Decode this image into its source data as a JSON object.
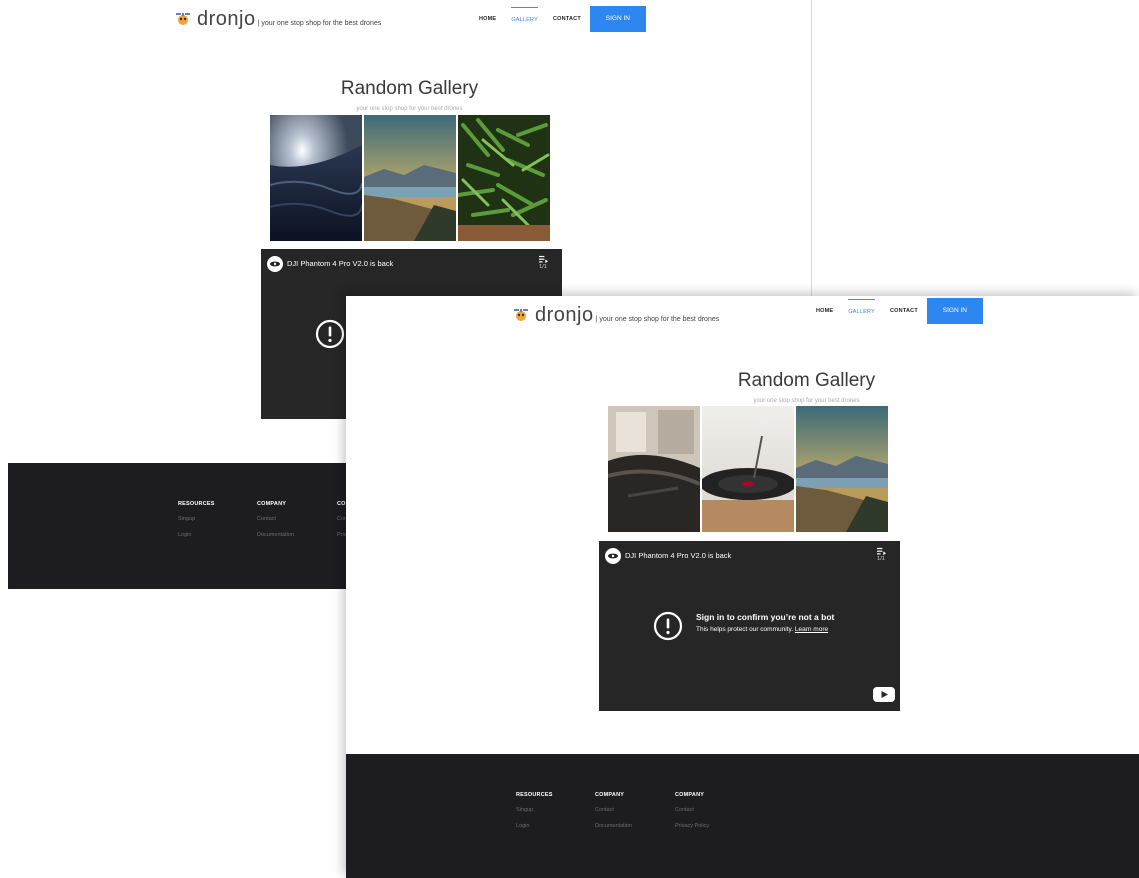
{
  "site": {
    "brand": "dronjo",
    "tagline": "| your one stop shop for the best drones",
    "logo_icon": "drone-mascot-icon"
  },
  "nav": {
    "items": [
      {
        "label": "HOME",
        "active": false
      },
      {
        "label": "GALLERY",
        "active": true
      },
      {
        "label": "CONTACT",
        "active": false
      }
    ],
    "signin_label": "SIGN IN"
  },
  "gallery": {
    "title": "Random Gallery",
    "subtitle": "your one stop shop for your best drones"
  },
  "back_photos": [
    {
      "name": "ocean-wave-photo"
    },
    {
      "name": "mountain-lake-sunset-photo"
    },
    {
      "name": "green-leaves-photo"
    }
  ],
  "front_photos": [
    {
      "name": "car-interior-photo"
    },
    {
      "name": "record-player-photo"
    },
    {
      "name": "mountain-lake-sunset-photo"
    }
  ],
  "video": {
    "title": "DJI Phantom 4 Pro V2.0 is back",
    "playlist_count": "1/1",
    "alert_title": "Sign in to confirm you’re not a bot",
    "alert_message": "This helps protect our community.",
    "alert_link": "Learn more",
    "channel_icon": "dji-logo-icon",
    "playlist_icon": "playlist-icon",
    "player_logo": "youtube-icon"
  },
  "footer": {
    "columns": [
      {
        "heading": "RESOURCES",
        "links": [
          "Singup",
          "Login"
        ]
      },
      {
        "heading": "COMPANY",
        "links": [
          "Contact",
          "Documentation"
        ]
      },
      {
        "heading": "COMPANY",
        "links": [
          "Contact",
          "Privacy Policy"
        ]
      }
    ]
  },
  "colors": {
    "accent": "#2e86f0",
    "footer_bg": "#1d1d21",
    "video_bg": "#262626"
  }
}
